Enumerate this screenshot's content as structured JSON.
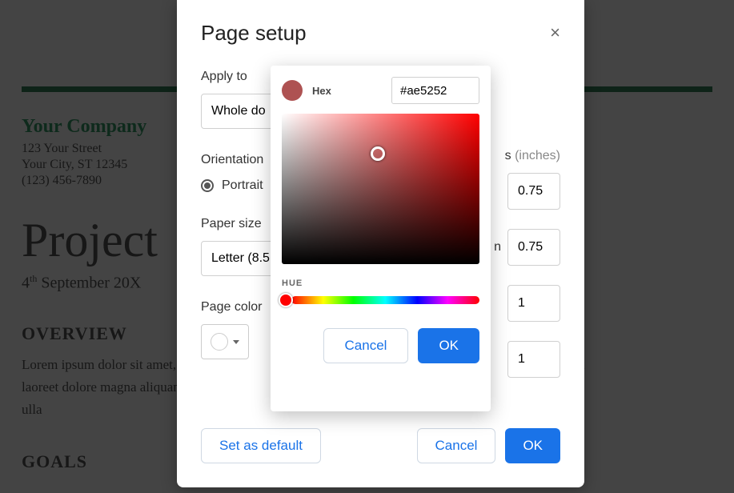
{
  "doc": {
    "company": "Your Company",
    "addr1": "123 Your Street",
    "addr2": "Your City, ST 12345",
    "phone": "(123) 456-7890",
    "project_title": "Project",
    "date_day": "4",
    "date_sup": "th",
    "date_rest": " September 20X",
    "overview_h": "OVERVIEW",
    "overview_body": "Lorem ipsum dolor sit amet, consectetuer adipiscing elit, sed diam nonummy nibh euismod tincidunt ut laoreet dolore magna aliquam erat volutpat. Ut wisi enim ad minim veniam, quis nostrud exerci tation ulla",
    "goals_h": "GOALS"
  },
  "dialog": {
    "title": "Page setup",
    "apply_to_label": "Apply to",
    "apply_to_value": "Whole do",
    "orientation_label": "Orientation",
    "orientation_value": "Portrait",
    "paper_size_label": "Paper size",
    "paper_size_value": "Letter (8.5",
    "page_color_label": "Page color",
    "margins_label": "Margins",
    "margins_hint": "(inches)",
    "margins_side_n": "n",
    "margin_top": "0.75",
    "margin_bottom": "0.75",
    "margin_left": "1",
    "margin_right": "1",
    "set_default": "Set as default",
    "cancel": "Cancel",
    "ok": "OK"
  },
  "picker": {
    "hex_label": "Hex",
    "hex_value": "#ae5252",
    "hue_label": "HUE",
    "cancel": "Cancel",
    "ok": "OK",
    "swatch_color": "#ae5252"
  }
}
